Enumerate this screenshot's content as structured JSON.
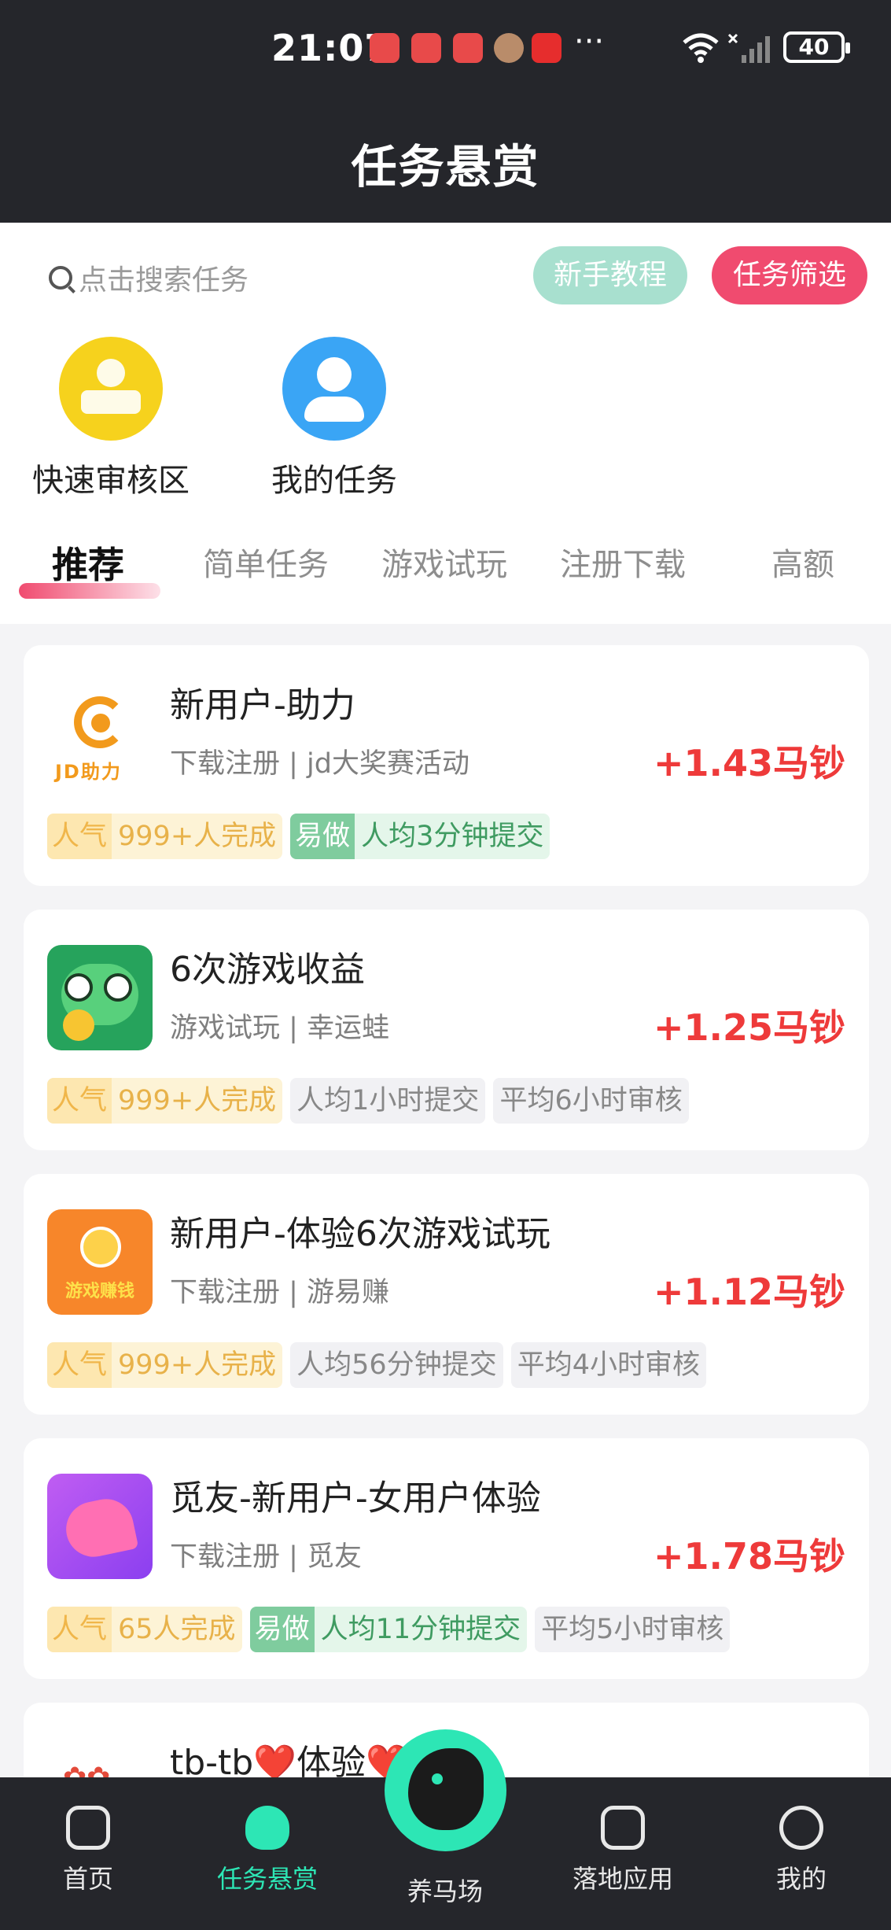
{
  "status_bar": {
    "time": "21:07",
    "battery": "40",
    "more": "···"
  },
  "header": {
    "title": "任务悬赏"
  },
  "search": {
    "placeholder": "点击搜索任务"
  },
  "buttons": {
    "tutorial": "新手教程",
    "filter": "任务筛选"
  },
  "quick_links": [
    {
      "label": "快速审核区",
      "icon": "stamp-icon",
      "color": "#f6d21d"
    },
    {
      "label": "我的任务",
      "icon": "person-icon",
      "color": "#3aa5f5"
    }
  ],
  "tabs": [
    {
      "label": "推荐",
      "active": true
    },
    {
      "label": "简单任务"
    },
    {
      "label": "游戏试玩"
    },
    {
      "label": "注册下载"
    },
    {
      "label": "高额"
    }
  ],
  "tasks": [
    {
      "title": "新用户-助力",
      "subtitle": "下载注册 | jd大奖赛活动",
      "reward": "+1.43马钞",
      "logo_text": "JD助力",
      "tags": [
        {
          "type": "pop",
          "key": "人气",
          "value": "999+人完成"
        },
        {
          "type": "easy",
          "key": "易做",
          "value": "人均3分钟提交"
        }
      ]
    },
    {
      "title": "6次游戏收益",
      "subtitle": "游戏试玩 | 幸运蛙",
      "reward": "+1.25马钞",
      "tags": [
        {
          "type": "pop",
          "key": "人气",
          "value": "999+人完成"
        },
        {
          "type": "gray",
          "value": "人均1小时提交"
        },
        {
          "type": "gray",
          "value": "平均6小时审核"
        }
      ]
    },
    {
      "title": "新用户-体验6次游戏试玩",
      "subtitle": "下载注册 | 游易赚",
      "reward": "+1.12马钞",
      "logo_text": "游戏赚钱",
      "tags": [
        {
          "type": "pop",
          "key": "人气",
          "value": "999+人完成"
        },
        {
          "type": "gray",
          "value": "人均56分钟提交"
        },
        {
          "type": "gray",
          "value": "平均4小时审核"
        }
      ]
    },
    {
      "title": "觅友-新用户-女用户体验",
      "subtitle": "下载注册 | 觅友",
      "reward": "+1.78马钞",
      "tags": [
        {
          "type": "pop",
          "key": "人气",
          "value": "65人完成"
        },
        {
          "type": "easy",
          "key": "易做",
          "value": "人均11分钟提交"
        },
        {
          "type": "gray",
          "value": "平均5小时审核"
        }
      ]
    },
    {
      "title": "tb-tb❤️体验❤️"
    }
  ],
  "bottom_nav": [
    {
      "label": "首页",
      "icon": "home-icon"
    },
    {
      "label": "任务悬赏",
      "icon": "bag-icon",
      "active": true
    },
    {
      "label": "养马场",
      "icon": "horse-icon"
    },
    {
      "label": "落地应用",
      "icon": "compass-icon"
    },
    {
      "label": "我的",
      "icon": "profile-icon"
    }
  ],
  "colors": {
    "header_bg": "#25262b",
    "accent_pink": "#f04b6f",
    "accent_mint": "#2de6b5",
    "reward_red": "#ee3a3a"
  }
}
